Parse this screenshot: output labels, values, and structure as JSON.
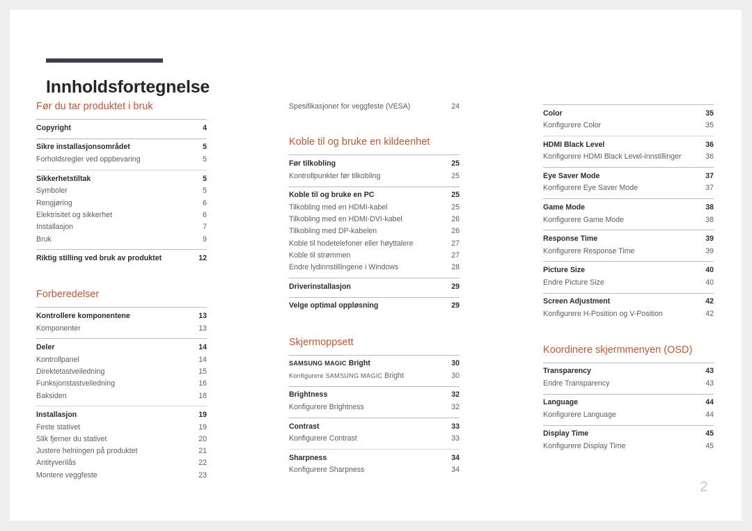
{
  "document": {
    "title": "Innholdsfortegnelse",
    "page_number": "2",
    "accent_color": "#cb5532",
    "rule_color": "#413d4e"
  },
  "columns": [
    {
      "sections": [
        {
          "heading": "Før du tar produktet i bruk",
          "groups": [
            {
              "rule": "solid",
              "entries": [
                {
                  "type": "main",
                  "label": "Copyright",
                  "page": "4"
                }
              ]
            },
            {
              "rule": "solid",
              "entries": [
                {
                  "type": "main",
                  "label": "Sikre installasjonsområdet",
                  "page": "5"
                },
                {
                  "type": "sub",
                  "label": "Forholdsregler ved oppbevaring",
                  "page": "5"
                }
              ]
            },
            {
              "rule": "faint",
              "entries": [
                {
                  "type": "main",
                  "label": "Sikkerhetstiltak",
                  "page": "5"
                },
                {
                  "type": "sub",
                  "label": "Symboler",
                  "page": "5"
                },
                {
                  "type": "sub",
                  "label": "Rengjøring",
                  "page": "6"
                },
                {
                  "type": "sub",
                  "label": "Elektrisitet og sikkerhet",
                  "page": "6"
                },
                {
                  "type": "sub",
                  "label": "Installasjon",
                  "page": "7"
                },
                {
                  "type": "sub",
                  "label": "Bruk",
                  "page": "9"
                }
              ]
            },
            {
              "rule": "solid",
              "entries": [
                {
                  "type": "main",
                  "label": "Riktig stilling ved bruk av produktet",
                  "page": "12"
                }
              ]
            }
          ]
        },
        {
          "heading": "Forberedelser",
          "groups": [
            {
              "rule": "solid",
              "entries": [
                {
                  "type": "main",
                  "label": "Kontrollere komponentene",
                  "page": "13"
                },
                {
                  "type": "sub",
                  "label": "Komponenter",
                  "page": "13"
                }
              ]
            },
            {
              "rule": "solid",
              "entries": [
                {
                  "type": "main",
                  "label": "Deler",
                  "page": "14"
                },
                {
                  "type": "sub",
                  "label": "Kontrollpanel",
                  "page": "14"
                },
                {
                  "type": "sub",
                  "label": "Direktetastveiledning",
                  "page": "15"
                },
                {
                  "type": "sub",
                  "label": "Funksjonstastveiledning",
                  "page": "16"
                },
                {
                  "type": "sub",
                  "label": "Baksiden",
                  "page": "18"
                }
              ]
            },
            {
              "rule": "faint",
              "entries": [
                {
                  "type": "main",
                  "label": "Installasjon",
                  "page": "19"
                },
                {
                  "type": "sub",
                  "label": "Feste stativet",
                  "page": "19"
                },
                {
                  "type": "sub",
                  "label": "Slik fjerner du stativet",
                  "page": "20"
                },
                {
                  "type": "sub",
                  "label": "Justere helningen på produktet",
                  "page": "21"
                },
                {
                  "type": "sub",
                  "label": "Antityverilås",
                  "page": "22"
                },
                {
                  "type": "sub",
                  "label": "Montere veggfeste",
                  "page": "23"
                }
              ]
            }
          ]
        }
      ]
    },
    {
      "sections": [
        {
          "heading": null,
          "groups": [
            {
              "rule": "none",
              "entries": [
                {
                  "type": "sub",
                  "label": "Spesifikasjoner for veggfeste (VESA)",
                  "page": "24"
                }
              ]
            }
          ]
        },
        {
          "heading": "Koble til og bruke en kildeenhet",
          "groups": [
            {
              "rule": "solid",
              "entries": [
                {
                  "type": "main",
                  "label": "Før tilkobling",
                  "page": "25"
                },
                {
                  "type": "sub",
                  "label": "Kontrollpunkter før tilkobling",
                  "page": "25"
                }
              ]
            },
            {
              "rule": "solid",
              "entries": [
                {
                  "type": "main",
                  "label": "Koble til og bruke en PC",
                  "page": "25"
                },
                {
                  "type": "sub",
                  "label": "Tilkobling med en HDMI-kabel",
                  "page": "25"
                },
                {
                  "type": "sub",
                  "label": "Tilkobling med en HDMI-DVI-kabel",
                  "page": "26"
                },
                {
                  "type": "sub",
                  "label": "Tilkobling med DP-kabelen",
                  "page": "26"
                },
                {
                  "type": "sub",
                  "label": "Koble til hodetelefoner eller høyttalere",
                  "page": "27"
                },
                {
                  "type": "sub",
                  "label": "Koble til strømmen",
                  "page": "27"
                },
                {
                  "type": "sub",
                  "label": "Endre lydinnstillingene i Windows",
                  "page": "28"
                }
              ]
            },
            {
              "rule": "solid",
              "entries": [
                {
                  "type": "main",
                  "label": "Driverinstallasjon",
                  "page": "29"
                }
              ]
            },
            {
              "rule": "solid",
              "entries": [
                {
                  "type": "main",
                  "label": "Velge optimal oppløsning",
                  "page": "29"
                }
              ]
            }
          ]
        },
        {
          "heading": "Skjermoppsett",
          "groups": [
            {
              "rule": "solid",
              "entries": [
                {
                  "type": "main",
                  "label": "SAMSUNG MAGIC Bright",
                  "page": "30",
                  "smallcaps_prefix": "SAMSUNG MAGIC",
                  "rest": " Bright"
                },
                {
                  "type": "sub",
                  "label": "Konfigurere SAMSUNG MAGIC Bright",
                  "page": "30",
                  "smallcaps_prefix": "Konfigurere SAMSUNG MAGIC",
                  "rest": " Bright"
                }
              ]
            },
            {
              "rule": "pink",
              "entries": [
                {
                  "type": "main",
                  "label": "Brightness",
                  "page": "32"
                },
                {
                  "type": "sub",
                  "label": "Konfigurere Brightness",
                  "page": "32"
                }
              ]
            },
            {
              "rule": "solid",
              "entries": [
                {
                  "type": "main",
                  "label": "Contrast",
                  "page": "33"
                },
                {
                  "type": "sub",
                  "label": "Konfigurere Contrast",
                  "page": "33"
                }
              ]
            },
            {
              "rule": "faint",
              "entries": [
                {
                  "type": "main",
                  "label": "Sharpness",
                  "page": "34"
                },
                {
                  "type": "sub",
                  "label": "Konfigurere Sharpness",
                  "page": "34"
                }
              ]
            }
          ]
        }
      ]
    },
    {
      "sections": [
        {
          "heading": null,
          "groups": [
            {
              "rule": "solid",
              "entries": [
                {
                  "type": "main",
                  "label": "Color",
                  "page": "35"
                },
                {
                  "type": "sub",
                  "label": "Konfigurere Color",
                  "page": "35"
                }
              ]
            },
            {
              "rule": "faint",
              "entries": [
                {
                  "type": "main",
                  "label": "HDMI Black Level",
                  "page": "36"
                },
                {
                  "type": "sub",
                  "label": "Konfigurere HDMI Black Level-innstillinger",
                  "page": "36"
                }
              ]
            },
            {
              "rule": "solid",
              "entries": [
                {
                  "type": "main",
                  "label": "Eye Saver Mode",
                  "page": "37"
                },
                {
                  "type": "sub",
                  "label": "Konfigurere Eye Saver Mode",
                  "page": "37"
                }
              ]
            },
            {
              "rule": "solid",
              "entries": [
                {
                  "type": "main",
                  "label": "Game Mode",
                  "page": "38"
                },
                {
                  "type": "sub",
                  "label": "Konfigurere Game Mode",
                  "page": "38"
                }
              ]
            },
            {
              "rule": "solid",
              "entries": [
                {
                  "type": "main",
                  "label": "Response Time",
                  "page": "39"
                },
                {
                  "type": "sub",
                  "label": "Konfigurere Response Time",
                  "page": "39"
                }
              ]
            },
            {
              "rule": "solid",
              "entries": [
                {
                  "type": "main",
                  "label": "Picture Size",
                  "page": "40"
                },
                {
                  "type": "sub",
                  "label": "Endre Picture Size",
                  "page": "40"
                }
              ]
            },
            {
              "rule": "solid",
              "entries": [
                {
                  "type": "main",
                  "label": "Screen Adjustment",
                  "page": "42"
                },
                {
                  "type": "sub",
                  "label": "Konfigurere H-Position og V-Position",
                  "page": "42"
                }
              ]
            }
          ]
        },
        {
          "heading": "Koordinere skjermmenyen (OSD)",
          "groups": [
            {
              "rule": "solid",
              "entries": [
                {
                  "type": "main",
                  "label": "Transparency",
                  "page": "43"
                },
                {
                  "type": "sub",
                  "label": "Endre Transparency",
                  "page": "43"
                }
              ]
            },
            {
              "rule": "solid",
              "entries": [
                {
                  "type": "main",
                  "label": "Language",
                  "page": "44"
                },
                {
                  "type": "sub",
                  "label": "Konfigurere Language",
                  "page": "44"
                }
              ]
            },
            {
              "rule": "solid",
              "entries": [
                {
                  "type": "main",
                  "label": "Display Time",
                  "page": "45"
                },
                {
                  "type": "sub",
                  "label": "Konfigurere Display Time",
                  "page": "45"
                }
              ]
            }
          ]
        }
      ]
    }
  ]
}
